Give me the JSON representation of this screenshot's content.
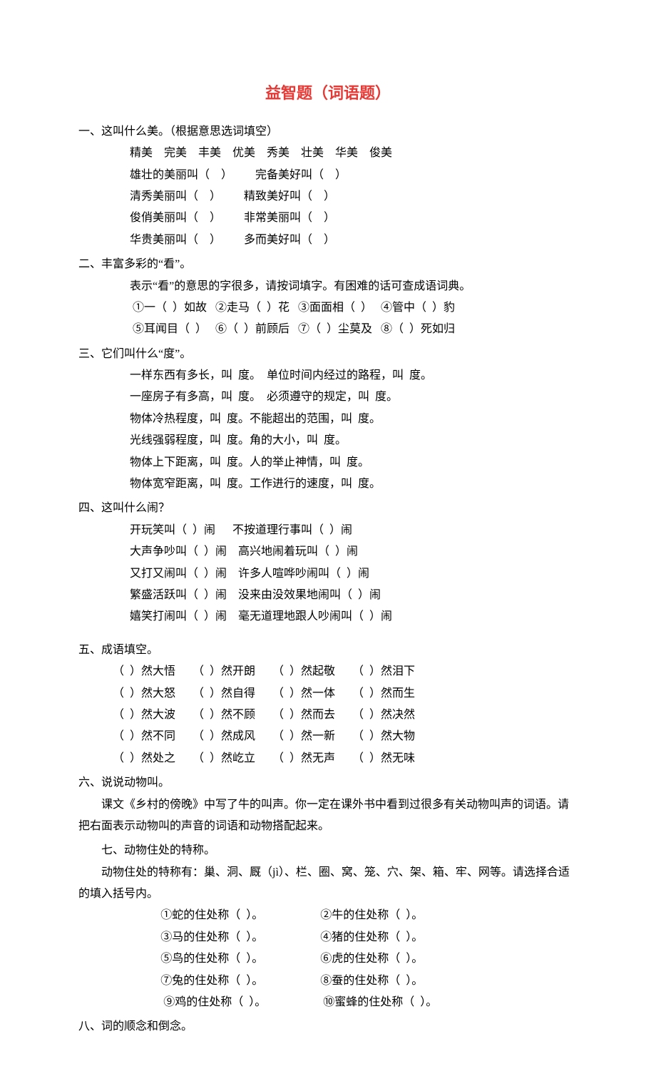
{
  "title": "益智题（词语题）",
  "s1": {
    "heading": "一、这叫什么美。（根据意思选词填空）",
    "options": "精美    完美    丰美    优美    秀美    壮美    华美    俊美",
    "r1": "雄壮的美丽叫（    ）        完备美好叫（    ）",
    "r2": "清秀美丽叫（    ）        精致美好叫（    ）",
    "r3": "俊俏美丽叫（    ）        非常美丽叫（    ）",
    "r4": "华贵美丽叫（    ）        多而美好叫（    ）"
  },
  "s2": {
    "heading": "二、丰富多彩的“看”。",
    "l1": "表示“看”的意思的字很多，请按词填字。有困难的话可查成语词典。",
    "l2": " ①一（  ）如故   ②走马（  ）花   ③面面相（  ）   ④管中（  ）豹",
    "l3": " ⑤耳闻目（  ）   ⑥（  ）前顾后   ⑦（  ）尘莫及   ⑧（  ）死如归"
  },
  "s3": {
    "heading": "三、它们叫什么“度”。",
    "l1": "一样东西有多长，叫  度。  单位时间内经过的路程，叫  度。",
    "l2": "一座房子有多高，叫  度。  必须遵守的规定，叫  度。",
    "l3": "物体冷热程度，叫  度。不能超出的范围，叫  度。",
    "l4": "光线强弱程度，叫  度。角的大小，叫  度。",
    "l5": "物体上下距离，叫  度。人的举止神情，叫  度。",
    "l6": "物体宽窄距离，叫  度。工作进行的速度，叫  度。"
  },
  "s4": {
    "heading": "四、这叫什么闹？",
    "l1": "开玩笑叫（  ）闹      不按道理行事叫（  ）闹",
    "l2": "大声争吵叫（  ）闹    高兴地闹着玩叫（  ）闹",
    "l3": "又打又闹叫（  ）闹    许多人喧哗吵闹叫（  ）闹",
    "l4": "繁盛活跃叫（  ）闹    没来由没效果地闹叫（  ）闹",
    "l5": "嬉笑打闹叫（  ）闹    毫无道理地跟人吵闹叫（  ）闹"
  },
  "s5": {
    "heading": "五、成语填空。",
    "r1": "（  ）然大悟      （  ）然开朗      （  ）然起敬      （  ）然泪下",
    "r2": "（  ）然大怒      （  ）然自得      （  ）然一体      （  ）然而生",
    "r3": "（  ）然大波      （  ）然不顾      （  ）然而去      （  ）然决然",
    "r4": "（  ）然不同      （  ）然成风      （  ）然一新      （  ）然大物",
    "r5": "（  ）然处之      （  ）然屹立      （  ）然无声      （  ）然无味"
  },
  "s6": {
    "heading": "六、说说动物叫。",
    "p1": "课文《乡村的傍晚》中写了牛的叫声。你一定在课外书中看到过很多有关动物叫声的词语。请把右面表示动物叫的声音的词语和动物搭配起来。"
  },
  "s7": {
    "heading": "七、动物住处的特称。",
    "p1": "动物住处的特称有：巢、洞、厩（jì）、栏、圈、窝、笼、穴、架、箱、牢、网等。请选择合适的填入括号内。",
    "r1": "①蛇的住处称（  ）。                    ②牛的住处称（  ）。",
    "r2": "③马的住处称（  ）。                    ④猪的住处称（  ）。",
    "r3": "⑤鸟的住处称（  ）。                    ⑥虎的住处称（  ）。",
    "r4": "⑦兔的住处称（  ）。                    ⑧蚕的住处称（  ）。",
    "r5": " ⑨鸡的住处称（  ）。                    ⑩蜜蜂的住处称（  ）。"
  },
  "s8": {
    "heading": "八、词的顺念和倒念。"
  }
}
